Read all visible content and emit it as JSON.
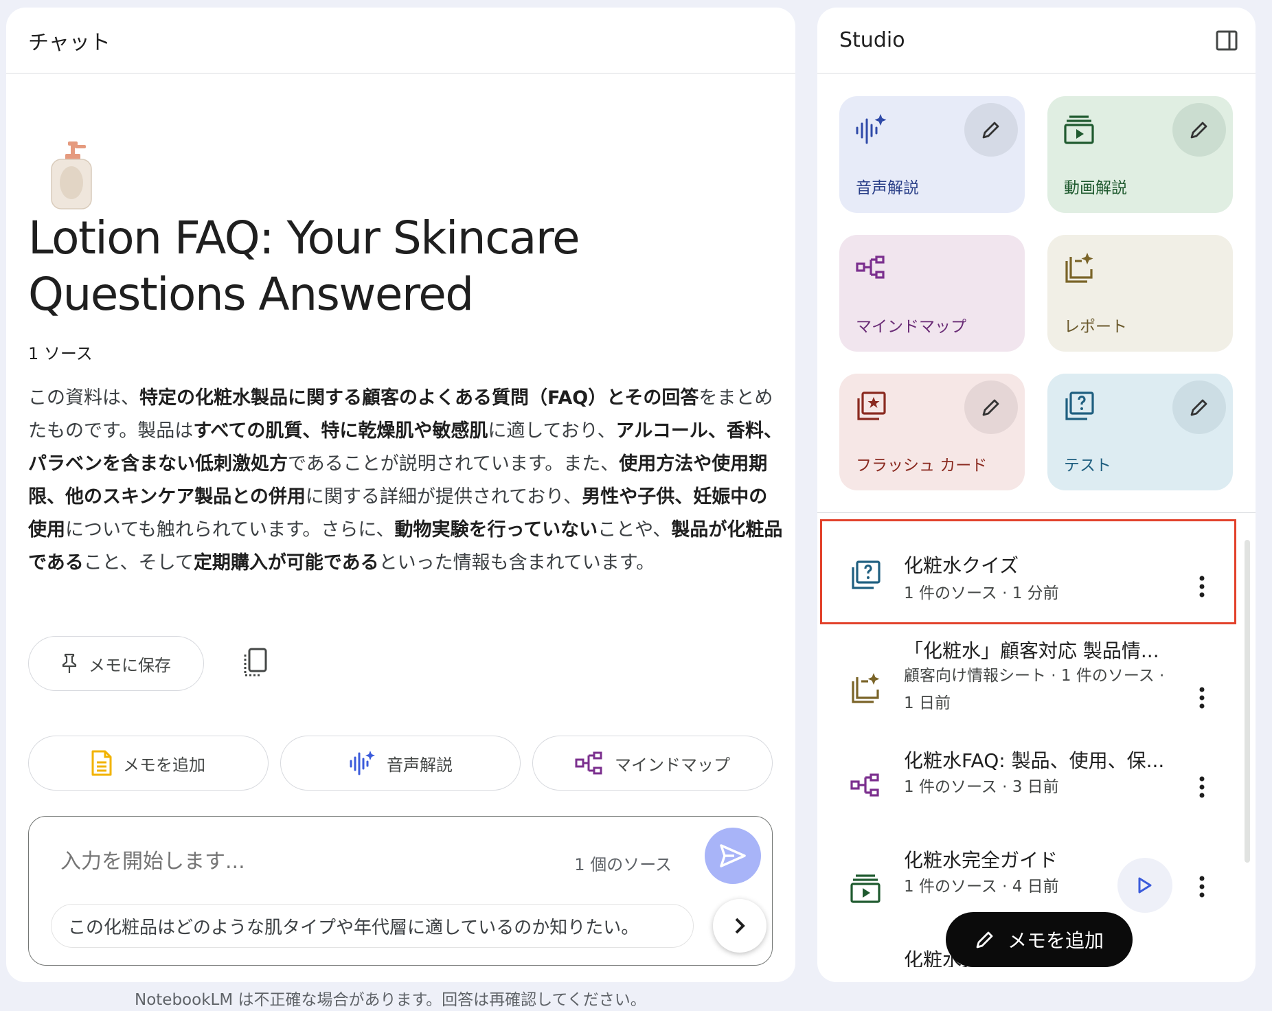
{
  "chat": {
    "header_title": "チャット",
    "title": "Lotion FAQ: Your Skincare Questions Answered",
    "source_count": "1 ソース",
    "summary": {
      "p1": "この資料は、",
      "b1": "特定の化粧水製品に関する顧客のよくある質問（FAQ）とその回答",
      "p2": "をまとめたものです。製品は",
      "b2": "すべての肌質、特に乾燥肌や敏感肌",
      "p3": "に適しており、",
      "b3": "アルコール、香料、パラベンを含まない低刺激処方",
      "p4": "であることが説明されています。また、",
      "b4": "使用方法や使用期限、他のスキンケア製品との併用",
      "p5": "に関する詳細が提供されており、",
      "b5": "男性や子供、妊娠中の使用",
      "p6": "についても触れられています。さらに、",
      "b6": "動物実験を行っていない",
      "p7": "ことや、",
      "b7": "製品が化粧品である",
      "p8": "こと、そして",
      "b8": "定期購入が可能である",
      "p9": "といった情報も含まれています。"
    },
    "save_memo_label": "メモに保存",
    "chips": {
      "add_memo": "メモを追加",
      "audio": "音声解説",
      "mindmap": "マインドマップ"
    },
    "composer": {
      "placeholder": "入力を開始します...",
      "source_count": "1 個のソース",
      "suggestion": "この化粧品はどのような肌タイプや年代層に適しているのか知りたい。"
    },
    "footer_note": "NotebookLM は不正確な場合があります。回答は再確認してください。"
  },
  "studio": {
    "header_title": "Studio",
    "tiles": {
      "audio": "音声解説",
      "video": "動画解説",
      "mindmap": "マインドマップ",
      "report": "レポート",
      "flashcard": "フラッシュ カード",
      "test": "テスト"
    },
    "items": [
      {
        "title": "化粧水クイズ",
        "meta": "1 件のソース · 1 分前",
        "icon": "quiz-icon"
      },
      {
        "title": "「化粧水」顧客対応 製品情...",
        "meta": "顧客向け情報シート · 1 件のソース · 1 日前",
        "icon": "report-icon"
      },
      {
        "title": "化粧水FAQ: 製品、使用、保...",
        "meta": "1 件のソース · 3 日前",
        "icon": "mindmap-icon"
      },
      {
        "title": "化粧水完全ガイド",
        "meta": "1 件のソース · 4 日前",
        "icon": "video-icon"
      },
      {
        "title": "化粧水完全版解説",
        "meta": "",
        "icon": "audio-icon"
      }
    ],
    "fab_label": "メモを追加"
  },
  "colors": {
    "highlight": "#e2412b",
    "send_button": "#a8b4f8",
    "background": "#eef0f8"
  }
}
